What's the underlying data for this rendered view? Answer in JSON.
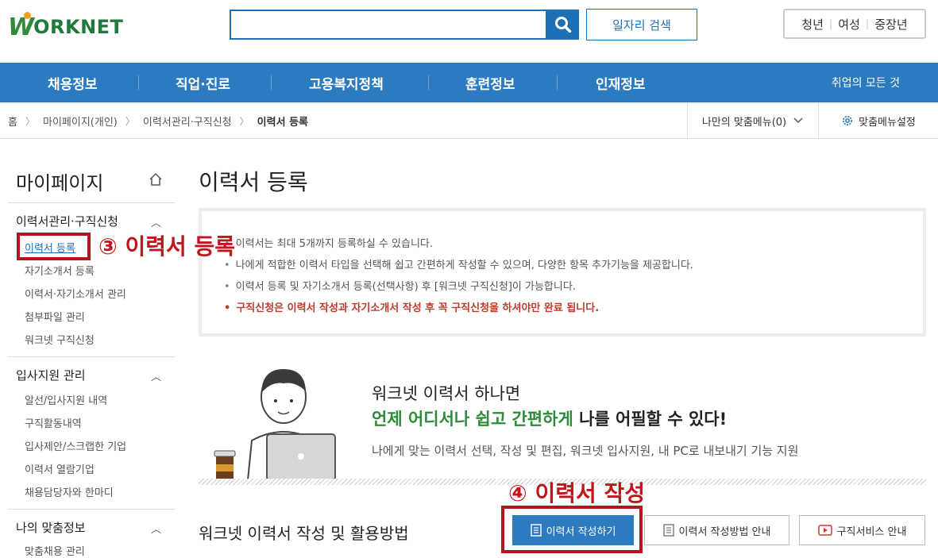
{
  "header": {
    "logo_text": "ORKNET",
    "search_placeholder": "",
    "job_search_label": "일자리 검색",
    "groups": [
      "청년",
      "여성",
      "중장년"
    ]
  },
  "nav": {
    "items": [
      "채용정보",
      "직업·진로",
      "고용복지정책",
      "훈련정보",
      "인재정보"
    ],
    "right_label": "취업의 모든 것"
  },
  "breadcrumb": {
    "items": [
      "홈",
      "마이페이지(개인)",
      "이력서관리·구직신청",
      "이력서 등록"
    ],
    "my_menu_label": "나만의 맞춤메뉴(0)",
    "menu_setting_label": "맞춤메뉴설정"
  },
  "sidebar": {
    "title": "마이페이지",
    "sections": [
      {
        "title": "이력서관리·구직신청",
        "items": [
          "이력서 등록",
          "자기소개서 등록",
          "이력서·자기소개서 관리",
          "첨부파일 관리",
          "워크넷 구직신청"
        ]
      },
      {
        "title": "입사지원 관리",
        "items": [
          "알선/입사지원 내역",
          "구직활동내역",
          "입사제안/스크랩한 기업",
          "이력서 열람기업",
          "채용담당자와 한마디"
        ]
      },
      {
        "title": "나의 맞춤정보",
        "items": [
          "맞춤채용 관리"
        ]
      }
    ]
  },
  "annotations": {
    "step3": "③ 이력서 등록",
    "step4": "④ 이력서 작성"
  },
  "main": {
    "page_title": "이력서 등록",
    "info_lines": [
      "이력서는 최대 5개까지 등록하실 수 있습니다.",
      "나에게 적합한 이력서 타입을 선택해 쉽고 간편하게 작성할 수 있으며, 다양한 항목 추가기능을 제공합니다.",
      "이력서 등록 및 자기소개서 등록(선택사항) 후 [워크넷 구직신청]이 가능합니다.",
      "구직신청은 이력서 작성과 자기소개서 작성 후 꼭 구직신청을 하셔야만 완료 됩니다."
    ],
    "banner": {
      "line1": "워크넷 이력서 하나면",
      "line2_green": "언제 어디서나 쉽고 간편하게",
      "line2_rest": " 나를 어필할 수 있다!",
      "line3": "나에게 맞는 이력서 선택, 작성 및 편집, 워크넷 입사지원, 내 PC로 내보내기 기능 지원"
    },
    "usage_title": "워크넷 이력서 작성 및 활용방법",
    "buttons": {
      "write": "이력서 작성하기",
      "guide": "이력서 작성방법 안내",
      "service": "구직서비스 안내"
    }
  },
  "colors": {
    "primary": "#2c7bc0",
    "brand_green": "#2e8b3a",
    "annotation_red": "#c0151c"
  }
}
